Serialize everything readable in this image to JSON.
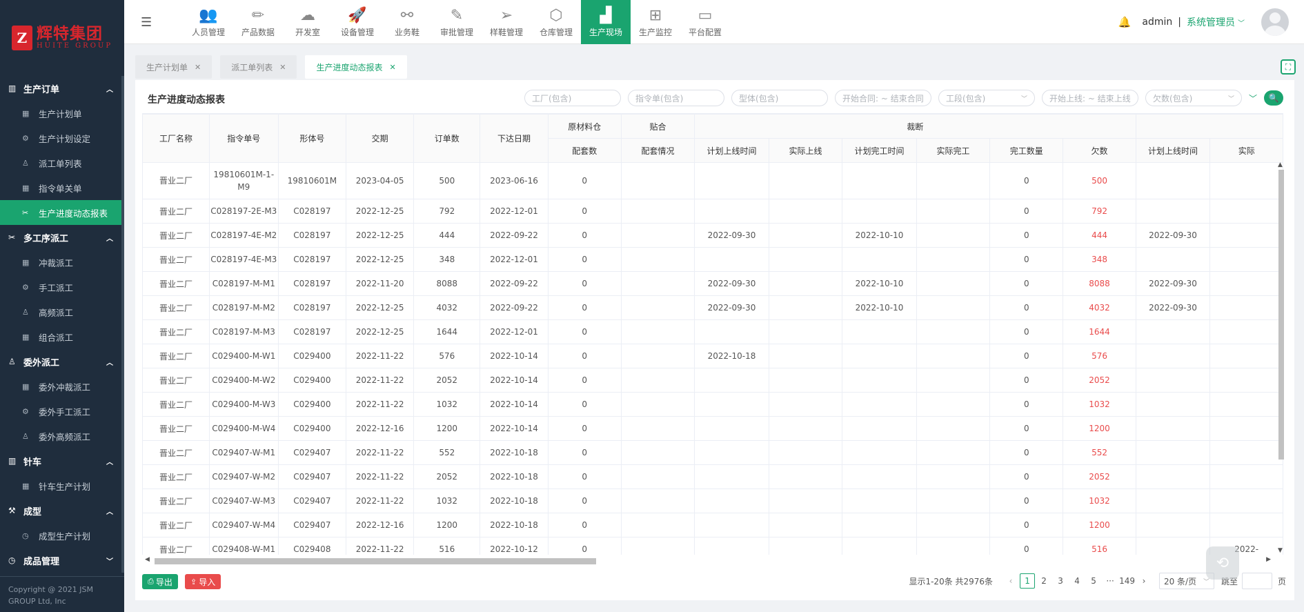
{
  "brand": {
    "logo_mark": "Z",
    "name_cn": "辉特集团",
    "name_en": "HUITE GROUP"
  },
  "sidebar": {
    "groups": [
      {
        "label": "生产订单",
        "icon": "building-icon",
        "items": [
          {
            "label": "生产计划单",
            "icon": "calendar-icon",
            "active": false
          },
          {
            "label": "生产计划设定",
            "icon": "gear-icon",
            "active": false
          },
          {
            "label": "派工单列表",
            "icon": "user-icon",
            "active": false
          },
          {
            "label": "指令单关单",
            "icon": "calendar-icon",
            "active": false
          },
          {
            "label": "生产进度动态报表",
            "icon": "scissors-icon",
            "active": true
          }
        ]
      },
      {
        "label": "多工序派工",
        "icon": "scissors-icon",
        "items": [
          {
            "label": "冲裁派工",
            "icon": "calendar-icon"
          },
          {
            "label": "手工派工",
            "icon": "gear-icon"
          },
          {
            "label": "高频派工",
            "icon": "user-icon"
          },
          {
            "label": "组合派工",
            "icon": "calendar-icon"
          }
        ]
      },
      {
        "label": "委外派工",
        "icon": "user-icon",
        "items": [
          {
            "label": "委外冲裁派工",
            "icon": "calendar-icon"
          },
          {
            "label": "委外手工派工",
            "icon": "gear-icon"
          },
          {
            "label": "委外高频派工",
            "icon": "user-icon"
          }
        ]
      },
      {
        "label": "针车",
        "icon": "building-icon",
        "items": [
          {
            "label": "针车生产计划",
            "icon": "calendar-icon"
          }
        ]
      },
      {
        "label": "成型",
        "icon": "hammer-icon",
        "items": [
          {
            "label": "成型生产计划",
            "icon": "clock-icon"
          }
        ]
      },
      {
        "label": "成品管理",
        "icon": "clock-icon",
        "collapsed": true,
        "items": []
      }
    ],
    "copyright_line1": "Copyright @ 2021 JSM",
    "copyright_line2": "GROUP Ltd, Inc"
  },
  "nav": {
    "items": [
      {
        "label": "人员管理",
        "icon": "users-icon",
        "glyph": "👥"
      },
      {
        "label": "产品数据",
        "icon": "pencil-ruler-icon",
        "glyph": "✏"
      },
      {
        "label": "开发室",
        "icon": "team-icon",
        "glyph": "☁"
      },
      {
        "label": "设备管理",
        "icon": "rocket-icon",
        "glyph": "🚀"
      },
      {
        "label": "业务鞋",
        "icon": "share-icon",
        "glyph": "⚯"
      },
      {
        "label": "审批管理",
        "icon": "edit-icon",
        "glyph": "✎"
      },
      {
        "label": "样鞋管理",
        "icon": "send-icon",
        "glyph": "➢"
      },
      {
        "label": "仓库管理",
        "icon": "box-icon",
        "glyph": "⬡"
      },
      {
        "label": "生产现场",
        "icon": "factory-icon",
        "glyph": "▟",
        "active": true
      },
      {
        "label": "生产监控",
        "icon": "org-chart-icon",
        "glyph": "⊞"
      },
      {
        "label": "平台配置",
        "icon": "monitor-icon",
        "glyph": "▭"
      }
    ]
  },
  "user": {
    "name": "admin",
    "separator": "|",
    "role": "系统管理员"
  },
  "tabs": [
    {
      "label": "生产计划单",
      "active": false
    },
    {
      "label": "派工单列表",
      "active": false
    },
    {
      "label": "生产进度动态报表",
      "active": true
    }
  ],
  "page": {
    "title": "生产进度动态报表",
    "filters": {
      "factory": "工厂(包含)",
      "order": "指令单(包含)",
      "shape": "型体(包含)",
      "contract": "开始合同: ~ 结束合同",
      "section": "工段(包含)",
      "online": "开始上线: ~ 结束上线",
      "owed": "欠数(包含)"
    }
  },
  "table": {
    "group_headers": {
      "raw": "原材料仓",
      "lamination": "贴合",
      "cutting": "裁断"
    },
    "headers": {
      "factory": "工厂名称",
      "order_no": "指令单号",
      "shape_no": "形体号",
      "due": "交期",
      "qty": "订单数",
      "issue_date": "下达日期",
      "match_count": "配套数",
      "match_status": "配套情况",
      "plan_online": "计划上线时间",
      "actual_online": "实际上线",
      "plan_finish": "计划完工时间",
      "actual_finish": "实际完工",
      "finished_qty": "完工数量",
      "owed": "欠数",
      "plan_online2": "计划上线时间",
      "actual2": "实际"
    },
    "rows": [
      [
        "晋业二厂",
        "19810601M-1-M9",
        "19810601M",
        "2023-04-05",
        "500",
        "2023-06-16",
        "0",
        "",
        "",
        "",
        "",
        "",
        "0",
        "500",
        "",
        ""
      ],
      [
        "晋业二厂",
        "C028197-2E-M3",
        "C028197",
        "2022-12-25",
        "792",
        "2022-12-01",
        "0",
        "",
        "",
        "",
        "",
        "",
        "0",
        "792",
        "",
        ""
      ],
      [
        "晋业二厂",
        "C028197-4E-M2",
        "C028197",
        "2022-12-25",
        "444",
        "2022-09-22",
        "0",
        "",
        "2022-09-30",
        "",
        "2022-10-10",
        "",
        "0",
        "444",
        "2022-09-30",
        ""
      ],
      [
        "晋业二厂",
        "C028197-4E-M3",
        "C028197",
        "2022-12-25",
        "348",
        "2022-12-01",
        "0",
        "",
        "",
        "",
        "",
        "",
        "0",
        "348",
        "",
        ""
      ],
      [
        "晋业二厂",
        "C028197-M-M1",
        "C028197",
        "2022-11-20",
        "8088",
        "2022-09-22",
        "0",
        "",
        "2022-09-30",
        "",
        "2022-10-10",
        "",
        "0",
        "8088",
        "2022-09-30",
        ""
      ],
      [
        "晋业二厂",
        "C028197-M-M2",
        "C028197",
        "2022-12-25",
        "4032",
        "2022-09-22",
        "0",
        "",
        "2022-09-30",
        "",
        "2022-10-10",
        "",
        "0",
        "4032",
        "2022-09-30",
        ""
      ],
      [
        "晋业二厂",
        "C028197-M-M3",
        "C028197",
        "2022-12-25",
        "1644",
        "2022-12-01",
        "0",
        "",
        "",
        "",
        "",
        "",
        "0",
        "1644",
        "",
        ""
      ],
      [
        "晋业二厂",
        "C029400-M-W1",
        "C029400",
        "2022-11-22",
        "576",
        "2022-10-14",
        "0",
        "",
        "2022-10-18",
        "",
        "",
        "",
        "0",
        "576",
        "",
        ""
      ],
      [
        "晋业二厂",
        "C029400-M-W2",
        "C029400",
        "2022-11-22",
        "2052",
        "2022-10-14",
        "0",
        "",
        "",
        "",
        "",
        "",
        "0",
        "2052",
        "",
        ""
      ],
      [
        "晋业二厂",
        "C029400-M-W3",
        "C029400",
        "2022-11-22",
        "1032",
        "2022-10-14",
        "0",
        "",
        "",
        "",
        "",
        "",
        "0",
        "1032",
        "",
        ""
      ],
      [
        "晋业二厂",
        "C029400-M-W4",
        "C029400",
        "2022-12-16",
        "1200",
        "2022-10-14",
        "0",
        "",
        "",
        "",
        "",
        "",
        "0",
        "1200",
        "",
        ""
      ],
      [
        "晋业二厂",
        "C029407-W-M1",
        "C029407",
        "2022-11-22",
        "552",
        "2022-10-18",
        "0",
        "",
        "",
        "",
        "",
        "",
        "0",
        "552",
        "",
        ""
      ],
      [
        "晋业二厂",
        "C029407-W-M2",
        "C029407",
        "2022-11-22",
        "2052",
        "2022-10-18",
        "0",
        "",
        "",
        "",
        "",
        "",
        "0",
        "2052",
        "",
        ""
      ],
      [
        "晋业二厂",
        "C029407-W-M3",
        "C029407",
        "2022-11-22",
        "1032",
        "2022-10-18",
        "0",
        "",
        "",
        "",
        "",
        "",
        "0",
        "1032",
        "",
        ""
      ],
      [
        "晋业二厂",
        "C029407-W-M4",
        "C029407",
        "2022-12-16",
        "1200",
        "2022-10-18",
        "0",
        "",
        "",
        "",
        "",
        "",
        "0",
        "1200",
        "",
        ""
      ],
      [
        "晋业二厂",
        "C029408-W-M1",
        "C029408",
        "2022-11-22",
        "516",
        "2022-10-12",
        "0",
        "",
        "",
        "",
        "",
        "",
        "0",
        "516",
        "",
        "2022-"
      ]
    ]
  },
  "actions": {
    "export_label": "导出",
    "import_label": "导入"
  },
  "pagination": {
    "summary": "显示1-20条 共2976条",
    "pages": [
      "1",
      "2",
      "3",
      "4",
      "5",
      "···",
      "149"
    ],
    "current": "1",
    "page_size": "20 条/页",
    "goto_label": "跳至",
    "page_unit": "页"
  },
  "colors": {
    "accent": "#1aa46f",
    "sidebar_bg": "#1f2d3d",
    "danger": "#e94b4b",
    "logo_red": "#d8262d"
  }
}
